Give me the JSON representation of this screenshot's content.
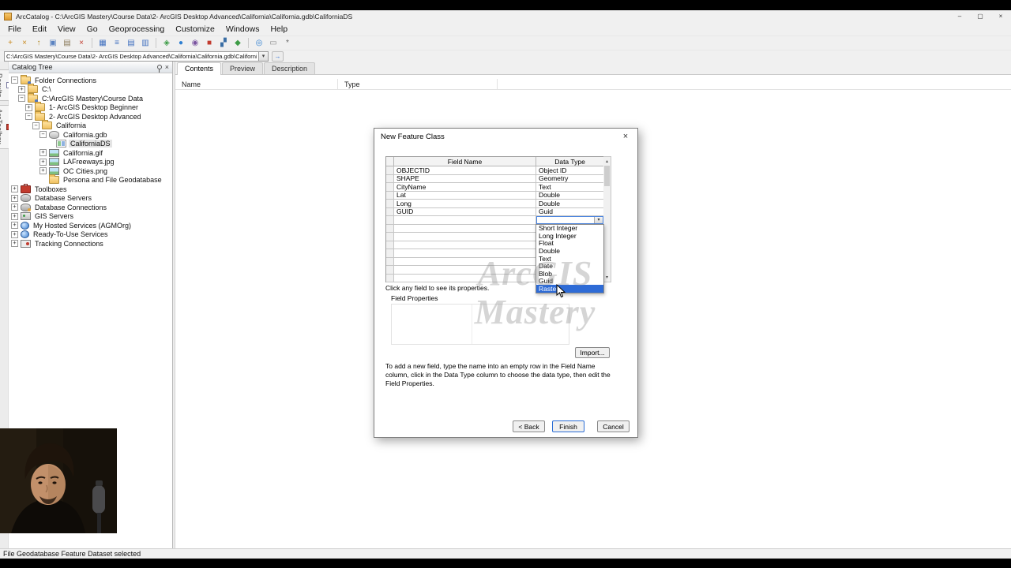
{
  "colors": {
    "accent": "#2a6dd5",
    "selection_blue": "#2e6bd6",
    "toolbox_red": "#c23b2e",
    "folder_yellow": "#f0c160",
    "chrome_gray": "#f0f0f0"
  },
  "window": {
    "title": "ArcCatalog - C:\\ArcGIS Mastery\\Course Data\\2- ArcGIS Desktop Advanced\\California\\California.gdb\\CaliforniaDS",
    "controls": [
      {
        "name": "minimize-button",
        "glyph": "–"
      },
      {
        "name": "maximize-button",
        "glyph": "▢"
      },
      {
        "name": "close-button",
        "glyph": "×"
      }
    ]
  },
  "menubar": {
    "items": [
      "File",
      "Edit",
      "View",
      "Go",
      "Geoprocessing",
      "Customize",
      "Windows",
      "Help"
    ]
  },
  "toolbar": {
    "groups": [
      [
        {
          "name": "connect-folder-icon",
          "glyph": "+",
          "color": "#c98a1e"
        },
        {
          "name": "disconnect-folder-icon",
          "glyph": "×",
          "color": "#c98a1e"
        },
        {
          "name": "up-one-level-icon",
          "glyph": "↑",
          "color": "#b0871e"
        },
        {
          "name": "copy-icon",
          "glyph": "▣",
          "color": "#5a82c0"
        },
        {
          "name": "paste-icon",
          "glyph": "▤",
          "color": "#8a7a5a"
        },
        {
          "name": "delete-icon",
          "glyph": "×",
          "color": "#c0392b"
        }
      ],
      [
        {
          "name": "large-icons-view-icon",
          "glyph": "▦",
          "color": "#3f6fbf"
        },
        {
          "name": "list-view-icon",
          "glyph": "≡",
          "color": "#3f6fbf"
        },
        {
          "name": "details-view-icon",
          "glyph": "▤",
          "color": "#3f6fbf"
        },
        {
          "name": "thumbnails-view-icon",
          "glyph": "▥",
          "color": "#3f6fbf"
        }
      ],
      [
        {
          "name": "launch-arcmap-icon",
          "glyph": "◈",
          "color": "#3d9c46"
        },
        {
          "name": "launch-arcglobe-icon",
          "glyph": "●",
          "color": "#2e7fd1"
        },
        {
          "name": "launch-arcscene-icon",
          "glyph": "◉",
          "color": "#7a54a0"
        },
        {
          "name": "arctoolbox-icon",
          "glyph": "■",
          "color": "#c23b2e"
        },
        {
          "name": "python-window-icon",
          "glyph": "▞",
          "color": "#3a6ea5"
        },
        {
          "name": "modelbuilder-icon",
          "glyph": "◆",
          "color": "#3d9c46"
        }
      ],
      [
        {
          "name": "search-icon",
          "glyph": "◎",
          "color": "#2e7fd1"
        },
        {
          "name": "metadata-icon",
          "glyph": "▭",
          "color": "#888888"
        },
        {
          "name": "options-icon",
          "glyph": "*",
          "color": "#666666"
        }
      ]
    ]
  },
  "addressbar": {
    "value": "C:\\ArcGIS Mastery\\Course Data\\2- ArcGIS Desktop Advanced\\California\\California.gdb\\CaliforniaDS"
  },
  "side_tabs": [
    {
      "label": "Results",
      "icon": "results"
    },
    {
      "label": "ArcToolbox",
      "icon": "arctoolbox"
    }
  ],
  "catalog_tree": {
    "title": "Catalog Tree",
    "items": [
      {
        "label": "Folder Connections",
        "level": 0,
        "expand": "minus",
        "icon": "folder-connections"
      },
      {
        "label": "C:\\",
        "level": 1,
        "expand": "plus",
        "icon": "folder"
      },
      {
        "label": "C:\\ArcGIS Mastery\\Course Data",
        "level": 1,
        "expand": "minus",
        "icon": "folder-connected"
      },
      {
        "label": "1- ArcGIS Desktop Beginner",
        "level": 2,
        "expand": "plus",
        "icon": "folder"
      },
      {
        "label": "2- ArcGIS Desktop Advanced",
        "level": 2,
        "expand": "minus",
        "icon": "folder-open"
      },
      {
        "label": "California",
        "level": 3,
        "expand": "minus",
        "icon": "folder-open"
      },
      {
        "label": "California.gdb",
        "level": 4,
        "expand": "minus",
        "icon": "geodatabase"
      },
      {
        "label": "CaliforniaDS",
        "level": 5,
        "expand": "none",
        "icon": "feature-dataset",
        "selected": true
      },
      {
        "label": "California.gif",
        "level": 4,
        "expand": "plus",
        "icon": "raster-image"
      },
      {
        "label": "LAFreeways.jpg",
        "level": 4,
        "expand": "plus",
        "icon": "raster-image"
      },
      {
        "label": "OC Cities.png",
        "level": 4,
        "expand": "plus",
        "icon": "raster-image"
      },
      {
        "label": "Persona and File Geodatabase",
        "level": 4,
        "expand": "none",
        "icon": "folder"
      },
      {
        "label": "Toolboxes",
        "level": 0,
        "expand": "plus",
        "icon": "toolbox"
      },
      {
        "label": "Database Servers",
        "level": 0,
        "expand": "plus",
        "icon": "database-servers"
      },
      {
        "label": "Database Connections",
        "level": 0,
        "expand": "plus",
        "icon": "database-connections"
      },
      {
        "label": "GIS Servers",
        "level": 0,
        "expand": "plus",
        "icon": "gis-servers"
      },
      {
        "label": "My Hosted Services (AGMOrg)",
        "level": 0,
        "expand": "plus",
        "icon": "hosted-services"
      },
      {
        "label": "Ready-To-Use Services",
        "level": 0,
        "expand": "plus",
        "icon": "ready-services"
      },
      {
        "label": "Tracking Connections",
        "level": 0,
        "expand": "plus",
        "icon": "tracking"
      }
    ]
  },
  "content_panel": {
    "tabs": [
      {
        "label": "Contents",
        "active": true
      },
      {
        "label": "Preview",
        "active": false
      },
      {
        "label": "Description",
        "active": false
      }
    ],
    "columns": [
      "Name",
      "Type"
    ]
  },
  "dialog": {
    "title": "New Feature Class",
    "grid": {
      "columns": [
        "Field Name",
        "Data Type"
      ],
      "rows": [
        {
          "field": "OBJECTID",
          "type": "Object ID"
        },
        {
          "field": "SHAPE",
          "type": "Geometry"
        },
        {
          "field": "CityName",
          "type": "Text"
        },
        {
          "field": "Lat",
          "type": "Double"
        },
        {
          "field": "Long",
          "type": "Double"
        },
        {
          "field": "GUID",
          "type": "Guid"
        }
      ]
    },
    "datatype_dropdown": {
      "options": [
        "Short Integer",
        "Long Integer",
        "Float",
        "Double",
        "Text",
        "Date",
        "Blob",
        "Guid",
        "Raster"
      ],
      "highlighted": "Raster"
    },
    "hint": "Click any field to see its properties.",
    "field_properties_label": "Field Properties",
    "import_button": "Import...",
    "instructions": "To add a new field, type the name into an empty row in the Field Name column, click in the Data Type column to choose the data type, then edit the Field Properties.",
    "buttons": {
      "back": "< Back",
      "finish": "Finish",
      "cancel": "Cancel"
    }
  },
  "status_bar": {
    "text": "File Geodatabase Feature Dataset selected"
  },
  "watermark": {
    "line1": "ArcGIS",
    "line2": "Mastery"
  }
}
